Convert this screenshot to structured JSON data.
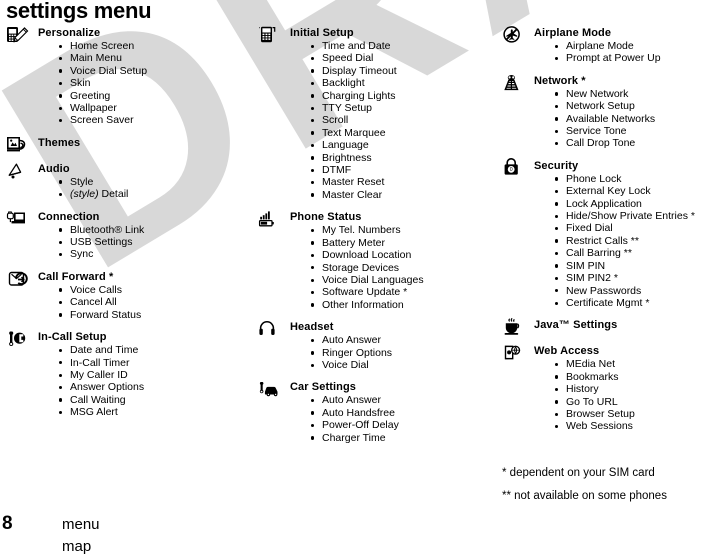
{
  "page": {
    "title": "settings menu",
    "footer_page_number": "8",
    "footer_label": "menu map"
  },
  "watermark": {
    "text": "DRAFT",
    "color": "#d8d8d8"
  },
  "footnotes": [
    "* dependent on your SIM card",
    "** not available on some phones"
  ],
  "columns": [
    {
      "id": "column-1",
      "sections": [
        {
          "icon": "personalize-icon",
          "title": "Personalize",
          "items": [
            "Home Screen",
            "Main Menu",
            "Voice Dial Setup",
            "Skin",
            "Greeting",
            "Wallpaper",
            "Screen Saver"
          ]
        },
        {
          "icon": "themes-icon",
          "title": "Themes",
          "items": []
        },
        {
          "icon": "audio-icon",
          "title": "Audio",
          "items": [
            "Style",
            "(style) Detail"
          ],
          "italic_items": [
            1
          ]
        },
        {
          "icon": "connection-icon",
          "title": "Connection",
          "items": [
            "Bluetooth® Link",
            "USB Settings",
            "Sync"
          ]
        },
        {
          "icon": "call-forward-icon",
          "title": "Call Forward *",
          "items": [
            "Voice Calls",
            "Cancel All",
            "Forward Status"
          ]
        },
        {
          "icon": "in-call-setup-icon",
          "title": "In-Call Setup",
          "items": [
            "Date and Time",
            "In-Call Timer",
            "My Caller ID",
            "Answer Options",
            "Call Waiting",
            "MSG Alert"
          ]
        }
      ]
    },
    {
      "id": "column-2",
      "sections": [
        {
          "icon": "initial-setup-icon",
          "title": "Initial Setup",
          "items": [
            "Time and Date",
            "Speed Dial",
            "Display Timeout",
            "Backlight",
            "Charging Lights",
            "TTY Setup",
            "Scroll",
            "Text Marquee",
            "Language",
            "Brightness",
            "DTMF",
            "Master Reset",
            "Master Clear"
          ]
        },
        {
          "icon": "phone-status-icon",
          "title": "Phone Status",
          "items": [
            "My Tel. Numbers",
            "Battery Meter",
            "Download Location",
            "Storage Devices",
            "Voice Dial Languages",
            "Software Update *",
            "Other Information"
          ]
        },
        {
          "icon": "headset-icon",
          "title": "Headset",
          "items": [
            "Auto Answer",
            "Ringer Options",
            "Voice Dial"
          ]
        },
        {
          "icon": "car-settings-icon",
          "title": "Car Settings",
          "items": [
            "Auto Answer",
            "Auto Handsfree",
            "Power-Off Delay",
            "Charger Time"
          ]
        }
      ]
    },
    {
      "id": "column-3",
      "sections": [
        {
          "icon": "airplane-mode-icon",
          "title": "Airplane Mode",
          "items": [
            "Airplane Mode",
            "Prompt at Power Up"
          ]
        },
        {
          "icon": "network-icon",
          "title": "Network *",
          "items": [
            "New Network",
            "Network Setup",
            "Available Networks",
            "Service Tone",
            "Call Drop Tone"
          ]
        },
        {
          "icon": "security-icon",
          "title": "Security",
          "items": [
            "Phone Lock",
            "External Key Lock",
            "Lock Application",
            "Hide/Show Private Entries *",
            "Fixed Dial",
            "Restrict Calls **",
            "Call Barring **",
            "SIM PIN",
            "SIM PIN2 *",
            "New Passwords",
            "Certificate Mgmt *"
          ]
        },
        {
          "icon": "java-settings-icon",
          "title": "Java™ Settings",
          "items": []
        },
        {
          "icon": "web-access-icon",
          "title": "Web Access",
          "items": [
            "MEdia Net",
            "Bookmarks",
            "History",
            "Go To URL",
            "Browser Setup",
            "Web Sessions"
          ]
        }
      ]
    }
  ]
}
